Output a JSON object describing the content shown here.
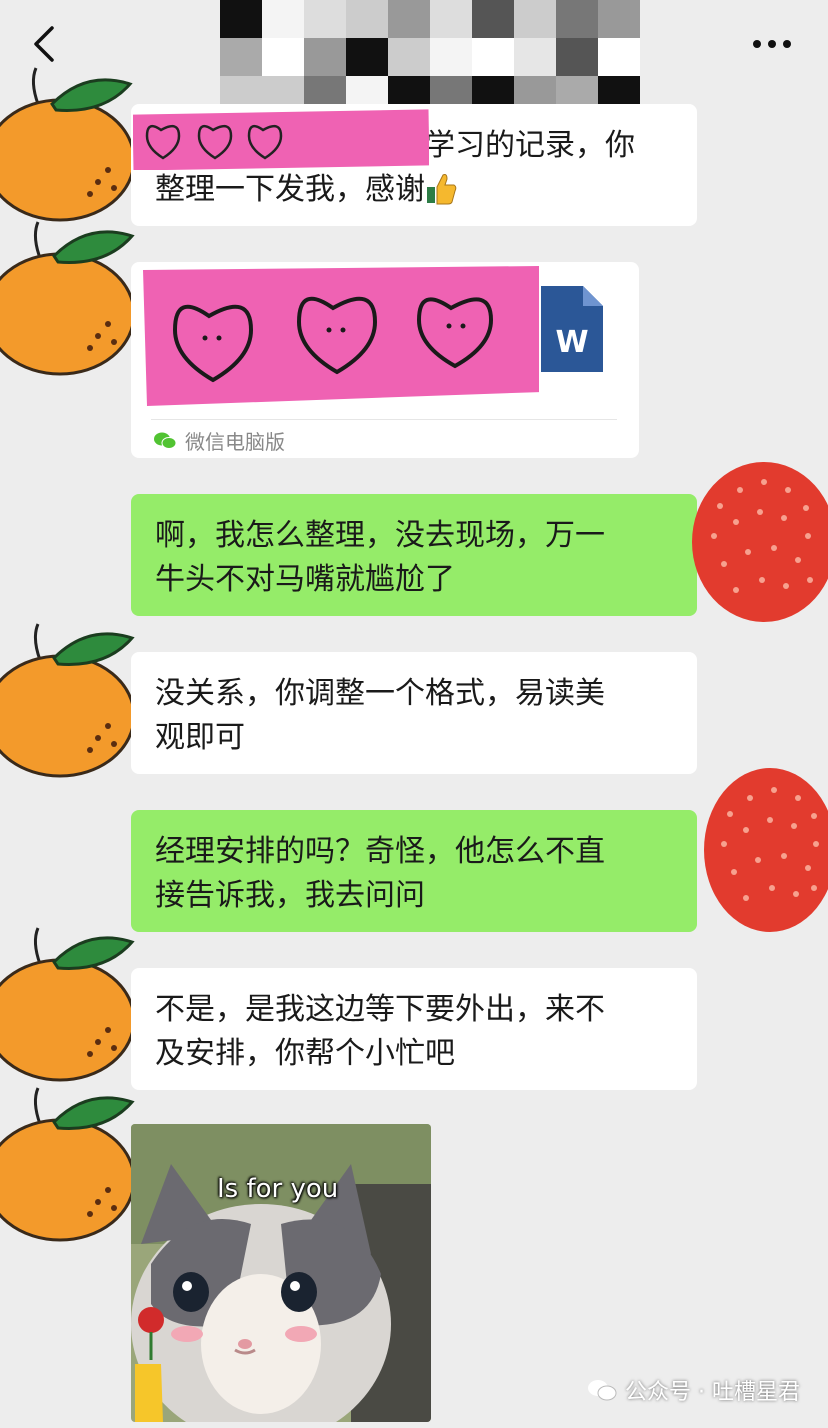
{
  "header": {
    "back_icon": "chevron-left-icon",
    "more_icon": "more-dots-icon",
    "title_obscured": true
  },
  "messages": [
    {
      "side": "left",
      "avatar": "orange-avatar",
      "text_line1": "上周外出学习的记录，你",
      "text_line2": "整理一下发我，感谢",
      "emoji": "thumbs-up-icon"
    },
    {
      "side": "left",
      "avatar": "orange-avatar",
      "type": "file",
      "file_icon": "word-doc-icon",
      "source": "微信电脑版"
    },
    {
      "side": "right",
      "avatar": "lychee-avatar",
      "text_line1": "啊，我怎么整理，没去现场，万一",
      "text_line2": "牛头不对马嘴就尴尬了"
    },
    {
      "side": "left",
      "avatar": "orange-avatar",
      "text_line1": "没关系，你调整一个格式，易读美",
      "text_line2": "观即可"
    },
    {
      "side": "right",
      "avatar": "lychee-avatar",
      "text_line1": "经理安排的吗？奇怪，他怎么不直",
      "text_line2": "接告诉我，我去问问"
    },
    {
      "side": "left",
      "avatar": "orange-avatar",
      "text_line1": "不是，是我这边等下要外出，来不",
      "text_line2": "及安排，你帮个小忙吧"
    },
    {
      "side": "left",
      "avatar": "orange-avatar",
      "type": "sticker",
      "caption": "Is for you"
    }
  ],
  "watermark": {
    "text": "公众号 · 吐槽星君",
    "icon": "wechat-icon"
  },
  "colors": {
    "background": "#ededed",
    "bubble_other": "#ffffff",
    "bubble_me": "#95ec69",
    "sticky_pink": "#ef62b3",
    "word_blue": "#2b5797"
  }
}
